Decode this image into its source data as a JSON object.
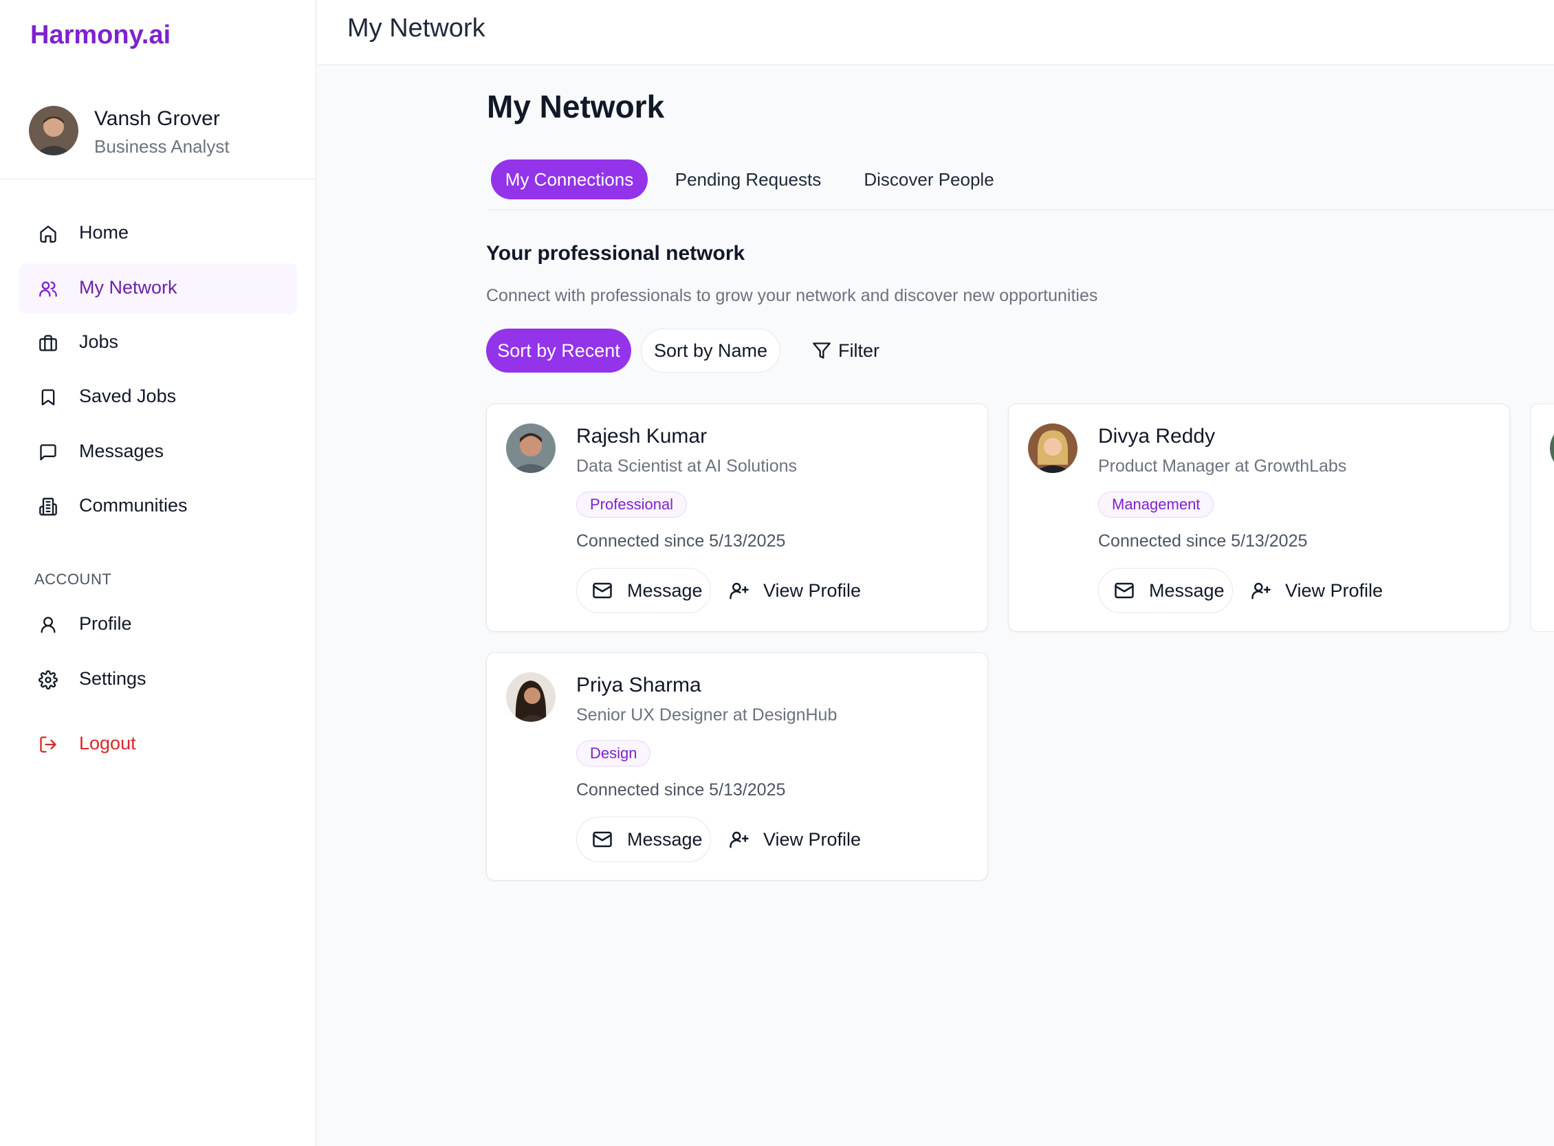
{
  "brand": "Harmony.ai",
  "user": {
    "name": "Vansh Grover",
    "role": "Business Analyst"
  },
  "nav": {
    "items": [
      {
        "label": "Home",
        "icon": "home-icon"
      },
      {
        "label": "My Network",
        "icon": "users-icon",
        "active": true
      },
      {
        "label": "Jobs",
        "icon": "briefcase-icon"
      },
      {
        "label": "Saved Jobs",
        "icon": "bookmark-icon"
      },
      {
        "label": "Messages",
        "icon": "message-square-icon"
      },
      {
        "label": "Communities",
        "icon": "building-icon"
      }
    ],
    "account_label": "ACCOUNT",
    "account_items": [
      {
        "label": "Profile",
        "icon": "user-icon"
      },
      {
        "label": "Settings",
        "icon": "gear-icon"
      }
    ],
    "logout_label": "Logout"
  },
  "header": {
    "title": "My Network"
  },
  "main": {
    "title": "My Network",
    "tabs": [
      {
        "label": "My Connections",
        "active": true
      },
      {
        "label": "Pending Requests"
      },
      {
        "label": "Discover People"
      }
    ],
    "section_title": "Your professional network",
    "section_subtitle": "Connect with professionals to grow your network and discover new opportunities",
    "sort_recent_label": "Sort by Recent",
    "sort_name_label": "Sort by Name",
    "filter_label": "Filter"
  },
  "connections": [
    {
      "name": "Rajesh Kumar",
      "title": "Data Scientist at AI Solutions",
      "tag": "Professional",
      "connected": "Connected since 5/13/2025",
      "message_label": "Message",
      "view_label": "View Profile"
    },
    {
      "name": "Divya Reddy",
      "title": "Product Manager at GrowthLabs",
      "tag": "Management",
      "connected": "Connected since 5/13/2025",
      "message_label": "Message",
      "view_label": "View Profile"
    },
    {
      "name": "Priya Sharma",
      "title": "Senior UX Designer at DesignHub",
      "tag": "Design",
      "connected": "Connected since 5/13/2025",
      "message_label": "Message",
      "view_label": "View Profile"
    }
  ],
  "colors": {
    "accent": "#9333ea",
    "brand": "#7e22ce",
    "logout": "#dc2626",
    "active_nav_bg": "#faf5ff"
  }
}
